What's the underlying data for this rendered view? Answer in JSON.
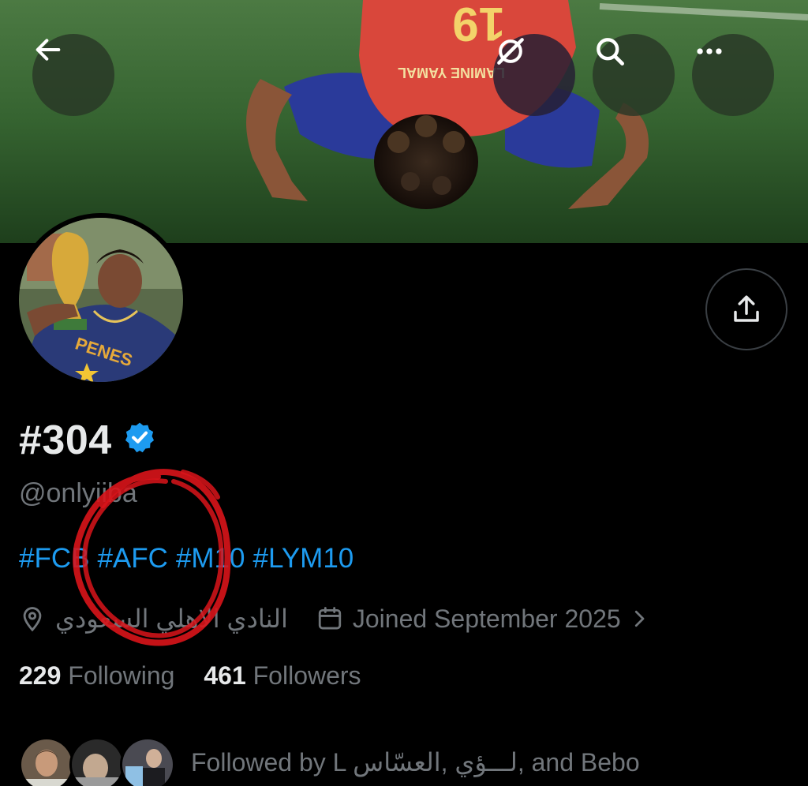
{
  "header": {
    "back_icon": "arrow-left-icon",
    "grok_icon": "grok-icon",
    "search_icon": "search-icon",
    "more_icon": "more-horizontal-icon",
    "banner_jersey_name": "LAMINE YAMAL",
    "banner_jersey_number": "19"
  },
  "profile": {
    "display_name": "#304",
    "verified": true,
    "handle": "@onlyiiba",
    "bio_tags": [
      "#FCB",
      "#AFC",
      "#M10",
      "#LYM10"
    ],
    "location": "النادي الاهلي السعودي",
    "joined": "Joined September 2025",
    "following_count": "229",
    "following_label": "Following",
    "followers_count": "461",
    "followers_label": "Followers",
    "followed_by_text": "Followed by L ‎العسّاس‎, ‎لـــؤي‎, and Bebo"
  },
  "colors": {
    "background": "#000000",
    "text_primary": "#e7e9ea",
    "text_secondary": "#71767b",
    "link": "#1d9bf0",
    "verified": "#1d9bf0",
    "annotation": "#d9141a"
  }
}
